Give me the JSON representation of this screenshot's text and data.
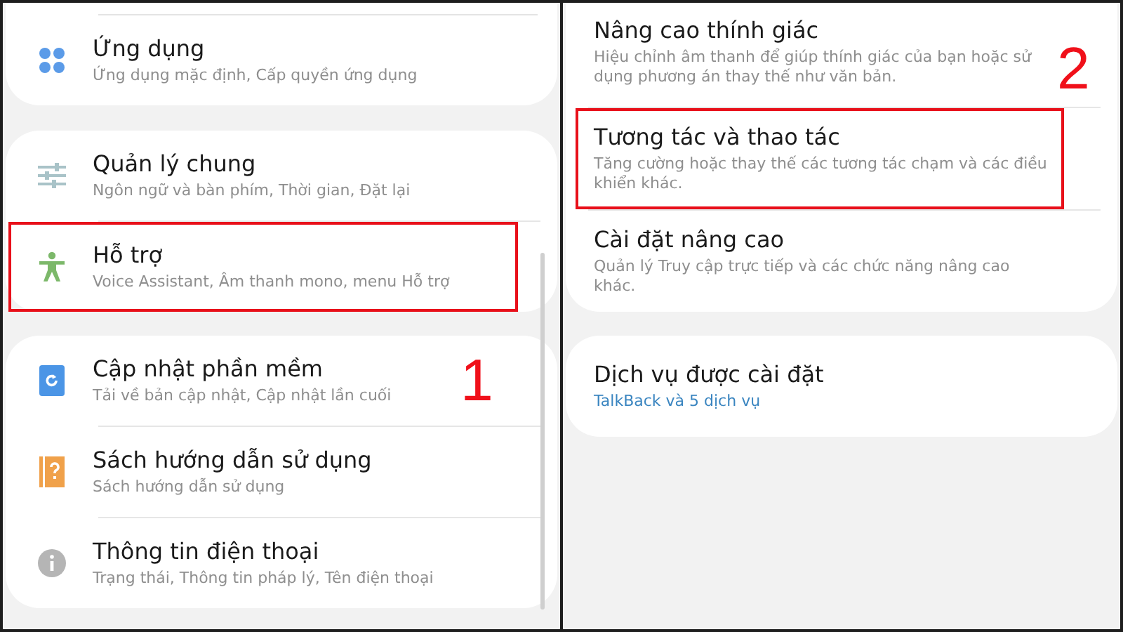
{
  "panels": [
    {
      "annotation": "1",
      "cards": [
        {
          "items": [
            {
              "kind": "apps",
              "title": "Ứng dụng",
              "subtitle": "Ứng dụng mặc định, Cấp quyền ứng dụng",
              "highlighted": false
            }
          ]
        },
        {
          "items": [
            {
              "kind": "sliders",
              "title": "Quản lý chung",
              "subtitle": "Ngôn ngữ và bàn phím, Thời gian, Đặt lại",
              "highlighted": false
            },
            {
              "kind": "accessibility",
              "title": "Hỗ trợ",
              "subtitle": "Voice Assistant, Âm thanh mono, menu Hỗ trợ",
              "highlighted": true
            }
          ]
        },
        {
          "items": [
            {
              "kind": "update",
              "title": "Cập nhật phần mềm",
              "subtitle": "Tải về bản cập nhật, Cập nhật lần cuối",
              "highlighted": false
            },
            {
              "kind": "manual",
              "title": "Sách hướng dẫn sử dụng",
              "subtitle": "Sách hướng dẫn sử dụng",
              "highlighted": false
            },
            {
              "kind": "info",
              "title": "Thông tin điện thoại",
              "subtitle": "Trạng thái, Thông tin pháp lý, Tên điện thoại",
              "highlighted": false
            }
          ]
        }
      ]
    },
    {
      "annotation": "2",
      "cards": [
        {
          "items": [
            {
              "title": "Nâng cao thính giác",
              "subtitle": "Hiệu chỉnh âm thanh để giúp thính giác của bạn hoặc sử dụng phương án thay thế như văn bản.",
              "highlighted": false
            },
            {
              "title": "Tương tác và thao tác",
              "subtitle": "Tăng cường hoặc thay thế các tương tác chạm và các điều khiển khác.",
              "highlighted": true
            },
            {
              "title": "Cài đặt nâng cao",
              "subtitle": "Quản lý Truy cập trực tiếp và các chức năng nâng cao khác.",
              "highlighted": false
            }
          ]
        },
        {
          "items": [
            {
              "title": "Dịch vụ được cài đặt",
              "subtitle": "TalkBack và 5 dịch vụ",
              "kind": "status",
              "highlighted": false
            }
          ]
        }
      ]
    }
  ]
}
